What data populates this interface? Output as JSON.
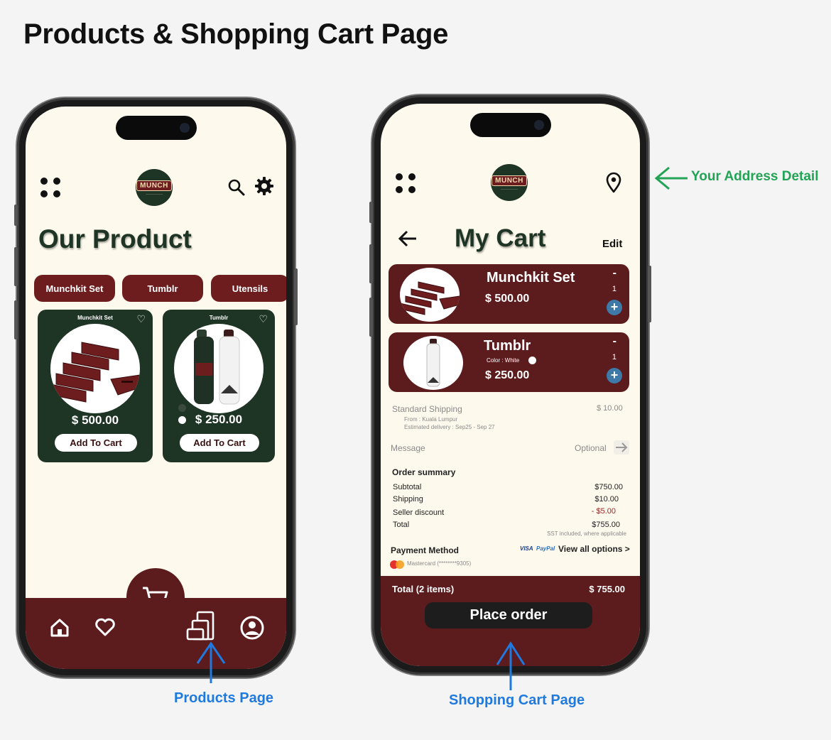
{
  "page_title": "Products & Shopping Cart Page",
  "products_screen": {
    "heading": "Our Product",
    "logo_text": "MUNCH",
    "tabs": [
      {
        "label": "Munchkit Set"
      },
      {
        "label": "Tumblr"
      },
      {
        "label": "Utensils"
      }
    ],
    "cards": [
      {
        "name": "Munchkit Set",
        "price": "$ 500.00",
        "button": "Add To Cart"
      },
      {
        "name": "Tumblr",
        "price": "$ 250.00",
        "button": "Add To Cart"
      }
    ],
    "icons": {
      "menu": "grid-dots-icon",
      "search": "search-icon",
      "settings": "gear-icon",
      "home": "home-icon",
      "favorites": "heart-icon",
      "cart": "cart-icon",
      "products": "products-icon",
      "profile": "profile-icon"
    }
  },
  "cart_screen": {
    "heading": "My Cart",
    "edit_label": "Edit",
    "logo_text": "MUNCH",
    "items": [
      {
        "name": "Munchkit Set",
        "price": "$ 500.00",
        "qty": "1",
        "minus": "-",
        "plus": "+"
      },
      {
        "name": "Tumblr",
        "color_label": "Color : White",
        "price": "$ 250.00",
        "qty": "1",
        "minus": "-",
        "plus": "+"
      }
    ],
    "shipping": {
      "label": "Standard Shipping",
      "price": "$ 10.00",
      "from": "From : Kuala Lumpur",
      "estimate": "Estimated delivery : Sep25 - Sep 27"
    },
    "message": {
      "label": "Message",
      "placeholder": "Optional"
    },
    "summary": {
      "title": "Order summary",
      "rows": [
        {
          "label": "Subtotal",
          "value": "$750.00"
        },
        {
          "label": "Shipping",
          "value": "$10.00"
        },
        {
          "label": "Seller discount",
          "value": "- $5.00"
        },
        {
          "label": "Total",
          "value": "$755.00"
        }
      ],
      "tax_note": "SST included, where applicable"
    },
    "payment": {
      "label": "Payment Method",
      "brands": [
        "VISA",
        "PayPal"
      ],
      "view_all": "View all options >",
      "card": "Mastercard (********9305)"
    },
    "checkout": {
      "total_label": "Total (2 items)",
      "total_value": "$ 755.00",
      "button": "Place order"
    },
    "colors": {
      "brand_red": "#5c1b1d",
      "brand_green": "#1e3424",
      "cream": "#fdf9ec"
    }
  },
  "annotations": {
    "products_page": "Products Page",
    "cart_page": "Shopping Cart Page",
    "address": "Your Address Detail"
  }
}
